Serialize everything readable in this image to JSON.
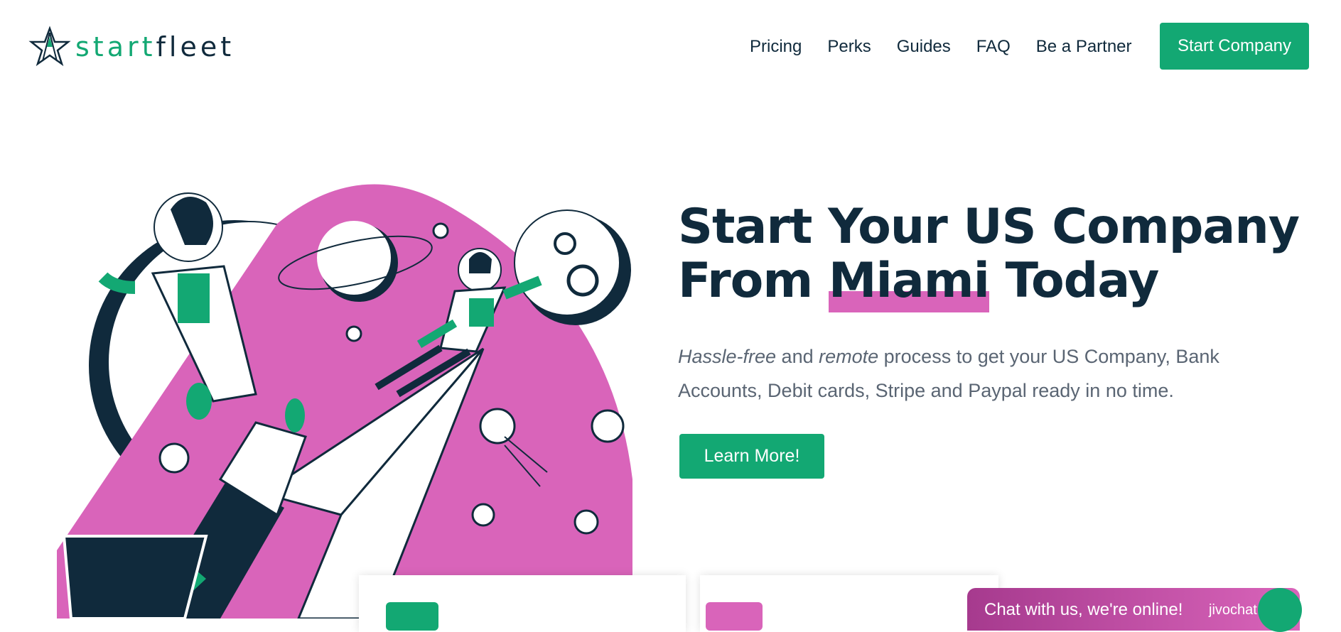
{
  "header": {
    "logo_text_a": "start",
    "logo_text_b": "fleet",
    "nav": [
      "Pricing",
      "Perks",
      "Guides",
      "FAQ",
      "Be a Partner"
    ],
    "cta_label": "Start Company"
  },
  "hero": {
    "title_line1": "Start Your US Company",
    "title_line2_pre": "From ",
    "title_highlight": "Miami",
    "title_line2_post": " Today",
    "sub_em1": "Hassle-free",
    "sub_mid1": " and ",
    "sub_em2": "remote",
    "sub_rest": " process to get your US Company, Bank Accounts, Debit cards, Stripe and Paypal ready in no time.",
    "button_label": "Learn More!"
  },
  "chat": {
    "label": "Chat with us, we're online!",
    "brand": "jivochat"
  },
  "colors": {
    "brand_green": "#13a873",
    "navy": "#102a3c",
    "pink": "#d964ba"
  },
  "icons": [
    "star-logo-icon",
    "chat-bubble-icon"
  ]
}
